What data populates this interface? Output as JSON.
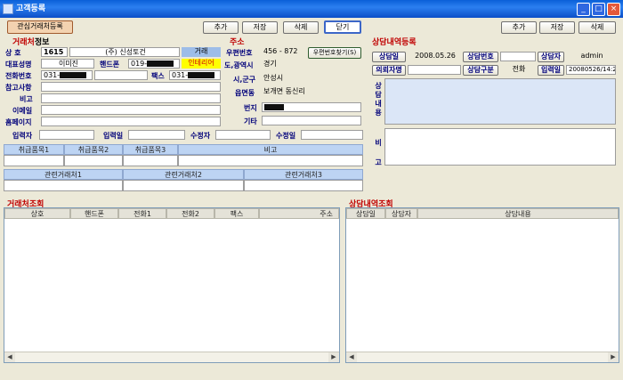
{
  "window": {
    "title": "고객등록",
    "minimize": "_",
    "maximize": "□",
    "close": "×"
  },
  "toolbar": {
    "fav": "관심거래처등록",
    "add": "추가",
    "save": "저장",
    "delete": "삭제",
    "close": "닫기"
  },
  "consult_toolbar": {
    "add": "추가",
    "save": "저장",
    "delete": "삭제"
  },
  "client": {
    "section_title": "거래처",
    "section_suffix": "정보",
    "fields": {
      "company": "상   호",
      "mobile": "핸드폰",
      "phone": "전화번호",
      "fax": "팩스",
      "rep": "대표성명",
      "memo": "참고사항",
      "note": "비고",
      "email": "이메일",
      "homepage": "홈페이지",
      "input_by": "입력자",
      "input_date": "입력일",
      "mod_by": "수정자",
      "mod_date": "수정일"
    },
    "values": {
      "code": "1615",
      "name": "(주) 신성토건",
      "type": "거래",
      "rep": "이미진",
      "mobile_prefix": "019-",
      "grade": "인테리어",
      "phone_prefix": "031-",
      "fax_prefix": "031-"
    }
  },
  "address": {
    "title": "주소",
    "zip_label": "우편번호",
    "zip_value": "456 - 872",
    "zip_button": "우편번호찾기(S)",
    "province_label": "도,광역시",
    "province_value": "경기",
    "city_label": "시,군구",
    "city_value": "안성시",
    "town_label": "읍면동",
    "town_value": "보개면 동신리",
    "lot_label": "번지",
    "etc_label": "기타"
  },
  "items": {
    "headers": [
      "취급품목1",
      "취급품목2",
      "취급품목3",
      "비고"
    ]
  },
  "related": {
    "headers": [
      "관련거래처1",
      "관련거래처2",
      "관련거래처3"
    ]
  },
  "consult": {
    "title": "상담내역등록",
    "date_label": "상담일",
    "date_value": "2008.05.26",
    "no_label": "상담번호",
    "staff_label": "상담자",
    "staff_value": "admin",
    "requester_label": "의뢰자명",
    "type_label": "상담구분",
    "type_value": "전화",
    "input_label": "입력일",
    "input_value": "20080526/14:2",
    "content_label": "상담내용",
    "remark_label": "비고"
  },
  "client_list": {
    "title": "거래처조회",
    "headers": [
      "상호",
      "핸드폰",
      "전화1",
      "전화2",
      "팩스",
      "주소"
    ]
  },
  "consult_list": {
    "title": "상담내역조회",
    "headers": [
      "상담일",
      "상담자",
      "상담내용"
    ]
  }
}
